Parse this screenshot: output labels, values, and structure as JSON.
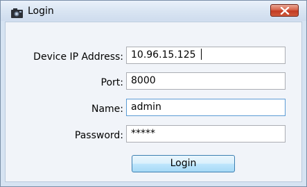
{
  "window": {
    "title": "Login",
    "icon": "camera-app-icon",
    "close_icon": "close-icon"
  },
  "form": {
    "device_ip": {
      "label": "Device IP Address:",
      "value": "10.96.15.125"
    },
    "port": {
      "label": "Port:",
      "value": "8000"
    },
    "name": {
      "label": "Name:",
      "value": "admin"
    },
    "password": {
      "label": "Password:",
      "value": "*****"
    }
  },
  "actions": {
    "login_label": "Login"
  },
  "colors": {
    "titlebar": "#d8e4f2",
    "close_button": "#c23a22",
    "login_button": "#bee6fd",
    "field_focus_border": "#5b9bd5"
  }
}
